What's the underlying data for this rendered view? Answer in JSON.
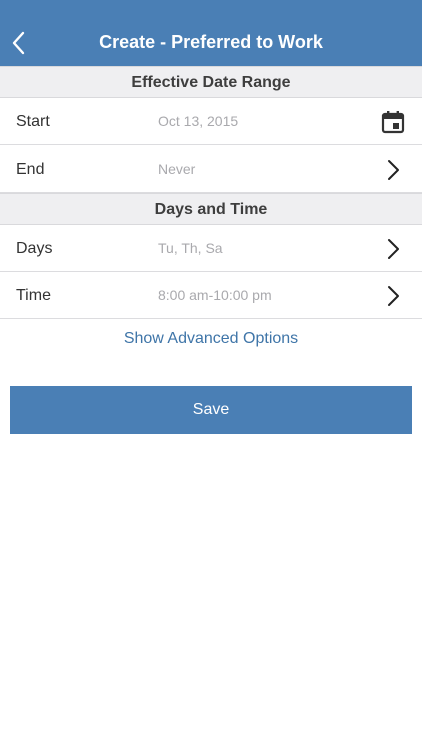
{
  "nav": {
    "back_icon": "chevron-left-icon",
    "title": "Create - Preferred to Work"
  },
  "sections": {
    "date_range": {
      "header": "Effective Date Range",
      "start": {
        "label": "Start",
        "value": "Oct 13, 2015",
        "icon": "calendar-icon"
      },
      "end": {
        "label": "End",
        "value": "Never",
        "icon": "chevron-right-icon"
      }
    },
    "days_time": {
      "header": "Days and Time",
      "days": {
        "label": "Days",
        "value": "Tu, Th, Sa",
        "icon": "chevron-right-icon"
      },
      "time": {
        "label": "Time",
        "value": "8:00 am-10:00 pm",
        "icon": "chevron-right-icon"
      }
    }
  },
  "advanced_link": "Show Advanced Options",
  "save_label": "Save",
  "colors": {
    "primary": "#4a7fb5",
    "link": "#3f75a8",
    "section_bg": "#efeff1"
  }
}
